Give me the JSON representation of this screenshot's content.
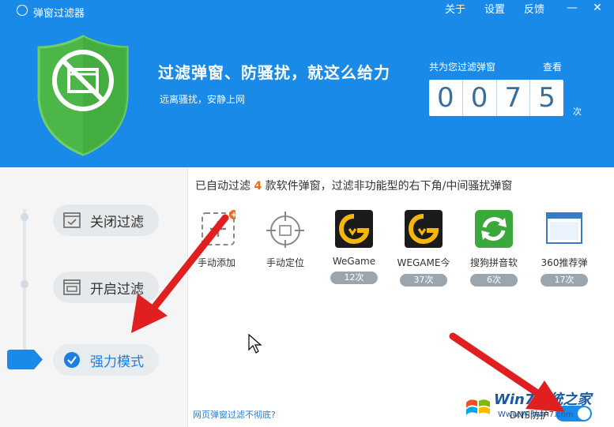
{
  "app": {
    "title": "弹窗过滤器",
    "menu": {
      "about": "关于",
      "settings": "设置",
      "feedback": "反馈"
    },
    "window_controls": {
      "minimize": "—",
      "close": "✕"
    }
  },
  "hero": {
    "headline": "过滤弹窗、防骚扰，就这么给力",
    "subline": "远离骚扰，安静上网",
    "count_label": "共为您过滤弹窗",
    "view_link": "查看",
    "digits": [
      "0",
      "0",
      "7",
      "5"
    ],
    "unit": "次"
  },
  "modes": {
    "off": "关闭过滤",
    "on": "开启过滤",
    "strong": "强力模式",
    "selected": "strong"
  },
  "filter": {
    "prefix": "已自动过滤 ",
    "count": "4",
    "suffix": " 款软件弹窗，过滤非功能型的右下角/中间骚扰弹窗"
  },
  "apps": [
    {
      "name": "手动添加",
      "count": ""
    },
    {
      "name": "手动定位",
      "count": ""
    },
    {
      "name": "WeGame",
      "count": "12次"
    },
    {
      "name": "WEGAME今",
      "count": "37次"
    },
    {
      "name": "搜狗拼音软",
      "count": "6次"
    },
    {
      "name": "360推荐弹",
      "count": "17次"
    }
  ],
  "footer": {
    "web_link": "网页弹窗过滤不彻底?",
    "dns_label": "DNS防护",
    "dns_enabled": true
  },
  "watermark": {
    "line1": "Win7系统之家",
    "line2": "Www.Winwin7.com"
  },
  "colors": {
    "header": "#1a8ae8",
    "shield": "#4cb648",
    "accent": "#1a7fe0",
    "count_highlight": "#f06a1a",
    "arrow": "#e02020"
  }
}
